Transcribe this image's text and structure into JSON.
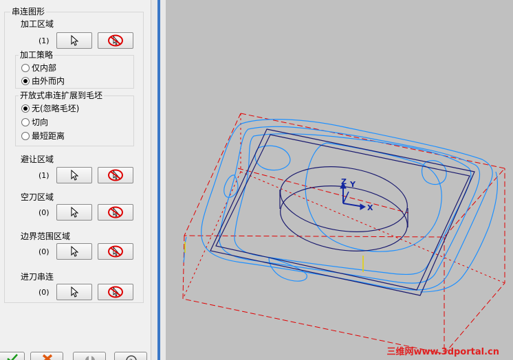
{
  "panel": {
    "chain_group": {
      "title": "串连图形"
    },
    "machining_region": {
      "label": "加工区域",
      "count": "(1)"
    },
    "strategy": {
      "title": "加工策略",
      "options": [
        {
          "label": "仅内部",
          "selected": false
        },
        {
          "label": "由外而内",
          "selected": true
        }
      ]
    },
    "open_chain": {
      "title": "开放式串连扩展到毛坯",
      "options": [
        {
          "label": "无(忽略毛坯)",
          "selected": true
        },
        {
          "label": "切向",
          "selected": false
        },
        {
          "label": "最短距离",
          "selected": false
        }
      ]
    },
    "avoid_region": {
      "label": "避让区域",
      "count": "(1)"
    },
    "air_region": {
      "label": "空刀区域",
      "count": "(0)"
    },
    "boundary_region": {
      "label": "边界范围区域",
      "count": "(0)"
    },
    "entry_chain": {
      "label": "进刀串连",
      "count": "(0)"
    }
  },
  "viewport": {
    "axes": {
      "x": "X",
      "y": "Y",
      "z": "Z"
    },
    "watermark": "三维网www.3dportal.cn"
  },
  "colors": {
    "part": "#1e90ff",
    "stock": "#e00000",
    "geometry": "#1a1a6e",
    "axes": "#1428a0"
  },
  "icons": [
    "arrow-select-icon",
    "clear-selection-icon",
    "ok-check-icon",
    "cancel-x-icon",
    "help-icon"
  ]
}
